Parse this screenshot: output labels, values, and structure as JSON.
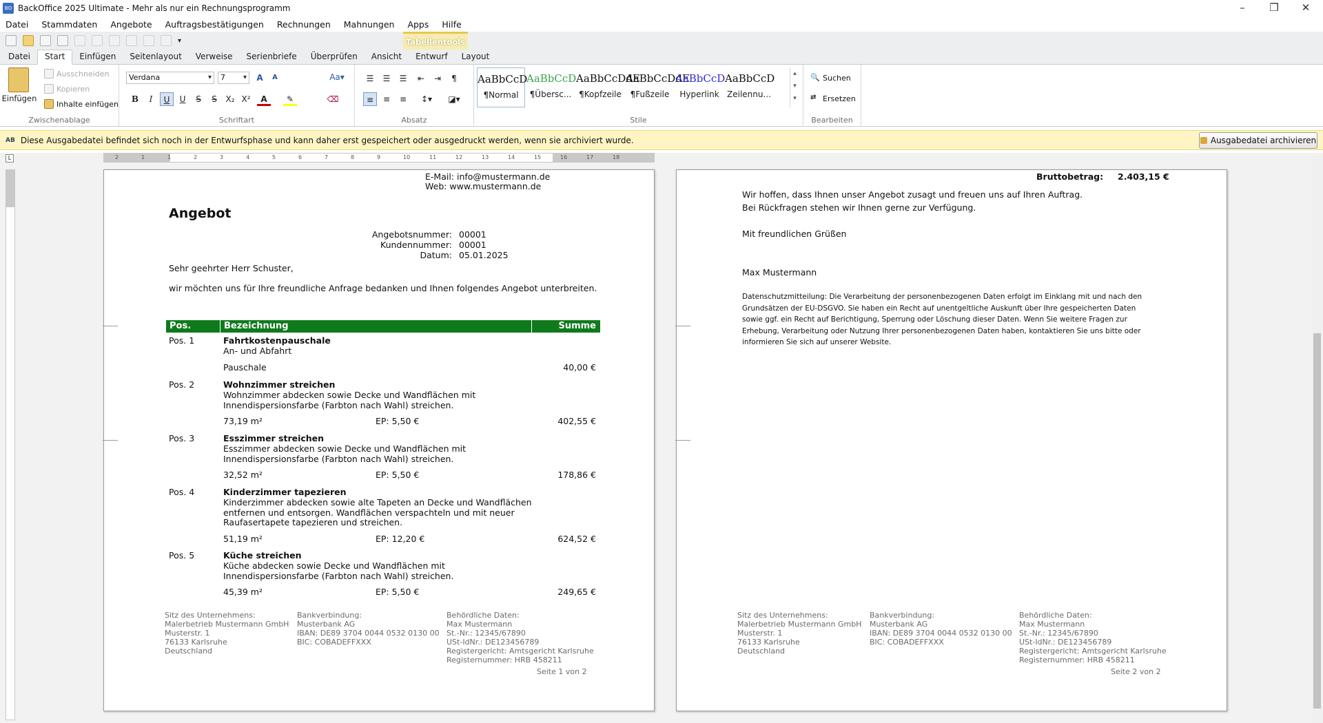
{
  "window": {
    "title": "BackOffice 2025 Ultimate - Mehr als nur ein Rechnungsprogramm",
    "app_icon": "BO"
  },
  "menu": [
    "Datei",
    "Stammdaten",
    "Angebote",
    "Auftragsbestätigungen",
    "Rechnungen",
    "Mahnungen",
    "Apps",
    "Hilfe"
  ],
  "contextual_tab": "Tabellentools",
  "tabs": [
    "Datei",
    "Start",
    "Einfügen",
    "Seitenlayout",
    "Verweise",
    "Serienbriefe",
    "Überprüfen",
    "Ansicht",
    "Entwurf",
    "Layout"
  ],
  "ribbon": {
    "clipboard": {
      "paste": "Einfügen",
      "cut": "Ausschneiden",
      "copy": "Kopieren",
      "paste_special": "Inhalte einfügen",
      "label": "Zwischenablage"
    },
    "font": {
      "family": "Verdana",
      "size": "7",
      "label": "Schriftart"
    },
    "paragraph": {
      "label": "Absatz"
    },
    "styles": {
      "label": "Stile",
      "items": [
        {
          "preview": "AaBbCcD",
          "name": "¶Normal",
          "color": "#111111"
        },
        {
          "preview": "AaBbCcD",
          "name": "¶Übersc...",
          "color": "#3aa34a"
        },
        {
          "preview": "AaBbCcDdE",
          "name": "¶Kopfzeile",
          "color": "#111111"
        },
        {
          "preview": "AaBbCcDdE",
          "name": "¶Fußzeile",
          "color": "#111111"
        },
        {
          "preview": "AaBbCcD",
          "name": "Hyperlink",
          "color": "#2b2bd8"
        },
        {
          "preview": "AaBbCcD",
          "name": "Zeilennu...",
          "color": "#111111"
        }
      ]
    },
    "edit": {
      "find": "Suchen",
      "replace": "Ersetzen",
      "label": "Bearbeiten"
    }
  },
  "infobar": {
    "badge": "AB",
    "message": "Diese Ausgabedatei befindet sich noch in der Entwurfsphase und kann daher erst gespeichert oder ausgedruckt werden, wenn sie archiviert wurde.",
    "button": "Ausgabedatei archivieren"
  },
  "doc": {
    "email": "E-Mail: info@mustermann.de",
    "web": "Web: www.mustermann.de",
    "title": "Angebot",
    "meta": [
      {
        "k": "Angebotsnummer:",
        "v": "00001"
      },
      {
        "k": "Kundennummer:",
        "v": "00001"
      },
      {
        "k": "Datum:",
        "v": "05.01.2025"
      }
    ],
    "salutation": "Sehr geehrter Herr Schuster,",
    "intro": "wir möchten uns für Ihre freundliche Anfrage bedanken und Ihnen folgendes Angebot unterbreiten.",
    "table_header": {
      "pos": "Pos.",
      "desc": "Bezeichnung",
      "sum": "Summe"
    },
    "positions": [
      {
        "pos": "Pos. 1",
        "name": "Fahrtkostenpauschale",
        "desc": [
          "An- und Abfahrt"
        ],
        "qty": "Pauschale",
        "ep": "",
        "sum": "40,00 €"
      },
      {
        "pos": "Pos. 2",
        "name": "Wohnzimmer streichen",
        "desc": [
          "Wohnzimmer abdecken sowie Decke und Wandflächen mit",
          "Innendispersionsfarbe (Farbton nach Wahl) streichen."
        ],
        "qty": "73,19 m²",
        "ep": "EP: 5,50 €",
        "sum": "402,55 €"
      },
      {
        "pos": "Pos. 3",
        "name": "Esszimmer streichen",
        "desc": [
          "Esszimmer abdecken sowie Decke und Wandflächen mit",
          "Innendispersionsfarbe (Farbton nach Wahl) streichen."
        ],
        "qty": "32,52 m²",
        "ep": "EP: 5,50 €",
        "sum": "178,86 €"
      },
      {
        "pos": "Pos. 4",
        "name": "Kinderzimmer tapezieren",
        "desc": [
          "Kinderzimmer abdecken sowie alte Tapeten an Decke und Wandflächen",
          "entfernen und entsorgen. Wandflächen verspachteln und mit neuer",
          "Raufasertapete tapezieren und streichen."
        ],
        "qty": "51,19 m²",
        "ep": "EP: 12,20 €",
        "sum": "624,52 €"
      },
      {
        "pos": "Pos. 5",
        "name": "Küche streichen",
        "desc": [
          "Küche abdecken sowie Decke und Wandflächen mit",
          "Innendispersionsfarbe (Farbton nach Wahl) streichen."
        ],
        "qty": "45,39 m²",
        "ep": "EP: 5,50 €",
        "sum": "249,65 €"
      }
    ],
    "footer": {
      "col1": {
        "h": "Sitz des Unternehmens:",
        "lines": [
          "Malerbetrieb Mustermann GmbH",
          "Musterstr. 1",
          "76133 Karlsruhe",
          "Deutschland"
        ]
      },
      "col2": {
        "h": "Bankverbindung:",
        "lines": [
          "Musterbank AG",
          "IBAN: DE89 3704 0044 0532 0130 00",
          "BIC: COBADEFFXXX"
        ]
      },
      "col3": {
        "h": "Behördliche Daten:",
        "lines": [
          "Max Mustermann",
          "St.-Nr.: 12345/67890",
          "USt-IdNr.: DE123456789",
          "Registergericht: Amtsgericht Karlsruhe",
          "Registernummer: HRB 458211"
        ]
      }
    },
    "page1": "Seite 1 von 2",
    "page2": "Seite 2 von 2",
    "brutto_label": "Bruttobetrag:",
    "brutto_value": "2.403,15 €",
    "closing1": "Wir hoffen, dass Ihnen unser Angebot zusagt und freuen uns auf Ihren Auftrag.",
    "closing2": "Bei Rückfragen stehen wir Ihnen gerne zur Verfügung.",
    "greeting": "Mit freundlichen Grüßen",
    "signature": "Max Mustermann",
    "privacy": [
      "Datenschutzmitteilung: Die Verarbeitung der personenbezogenen Daten erfolgt im Einklang mit und nach den",
      "Grundsätzen der EU-DSGVO. Sie haben ein Recht auf unentgeltliche Auskunft über Ihre gespeicherten Daten",
      "sowie ggf. ein Recht auf Berichtigung, Sperrung oder Löschung dieser Daten. Wenn Sie weitere Fragen zur",
      "Erhebung, Verarbeitung oder Nutzung Ihrer personenbezogenen Daten haben, kontaktieren Sie uns bitte oder",
      "informieren Sie sich auf unserer Website."
    ]
  },
  "ruler": {
    "h_ticks": [
      "2",
      "1",
      "1",
      "2",
      "3",
      "4",
      "5",
      "6",
      "7",
      "8",
      "9",
      "10",
      "11",
      "12",
      "13",
      "14",
      "15",
      "16",
      "17",
      "18"
    ]
  },
  "colors": {
    "table_header": "#0f7a1c",
    "footer_heading": "#49b04f",
    "infobar": "#fff5c4"
  }
}
